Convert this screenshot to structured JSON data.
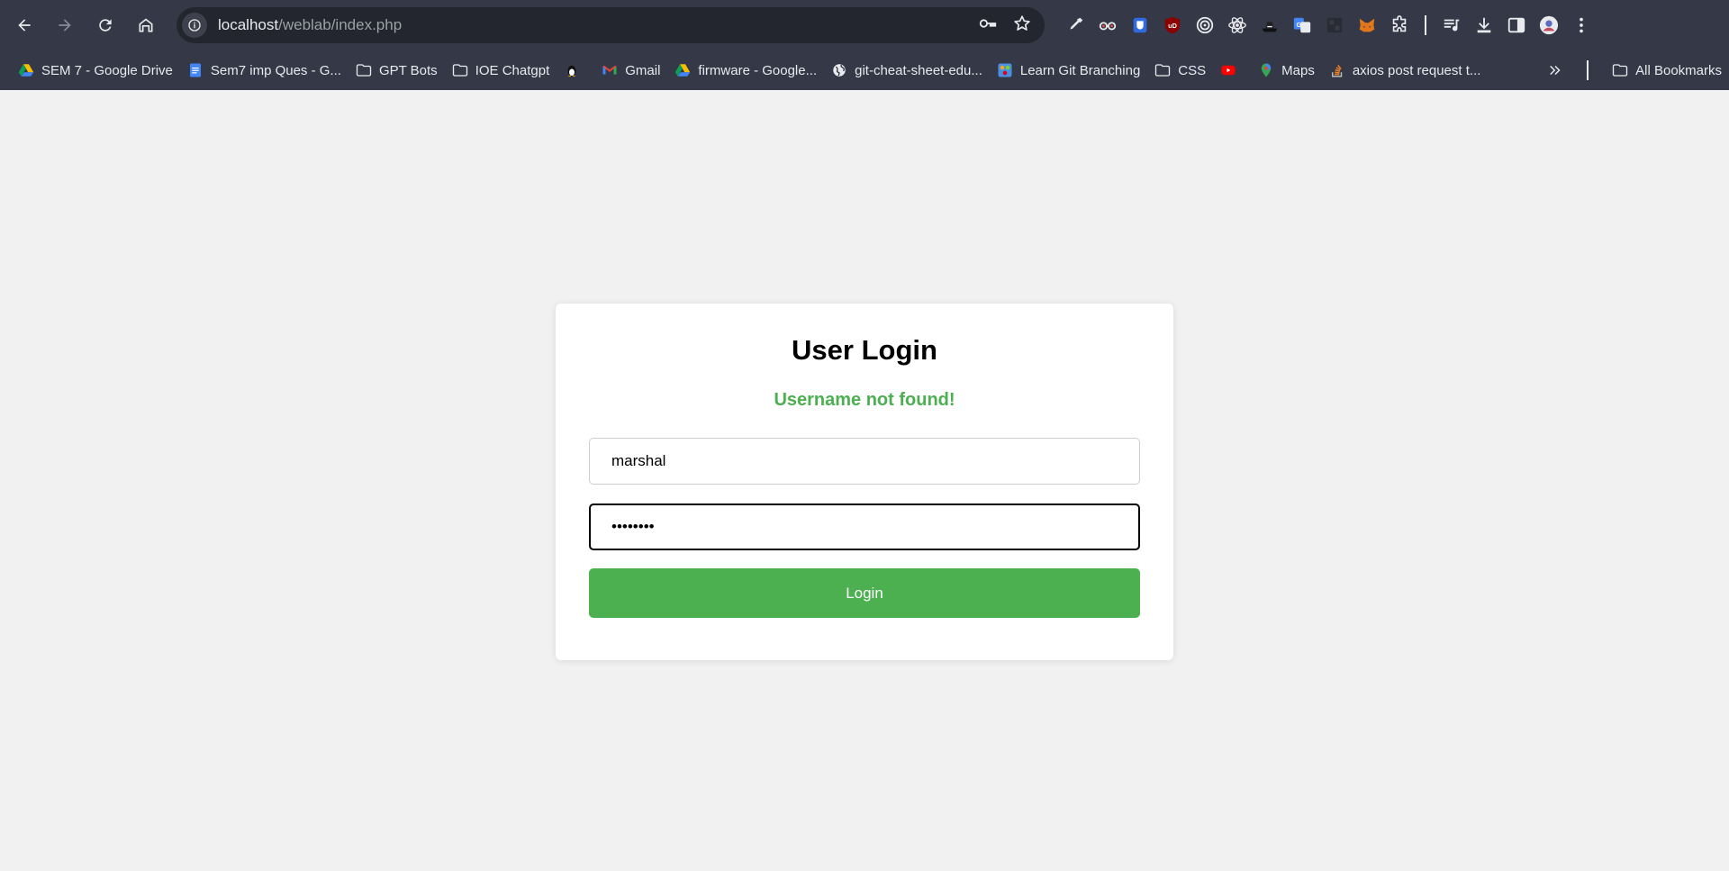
{
  "browser": {
    "url_host": "localhost",
    "url_path": "/weblab/index.php",
    "bookmarks": [
      {
        "label": "SEM 7 - Google Drive",
        "icon": "google-drive-icon"
      },
      {
        "label": "Sem7 imp Ques - G...",
        "icon": "google-docs-icon"
      },
      {
        "label": "GPT Bots",
        "icon": "folder-icon"
      },
      {
        "label": "IOE Chatgpt",
        "icon": "folder-icon"
      },
      {
        "label": "",
        "icon": "linux-penguin-icon"
      },
      {
        "label": "Gmail",
        "icon": "gmail-icon"
      },
      {
        "label": "firmware - Google...",
        "icon": "google-drive-icon"
      },
      {
        "label": "git-cheat-sheet-edu...",
        "icon": "globe-icon"
      },
      {
        "label": "Learn Git Branching",
        "icon": "learn-git-icon"
      },
      {
        "label": "CSS",
        "icon": "folder-icon"
      },
      {
        "label": "",
        "icon": "youtube-icon"
      },
      {
        "label": "Maps",
        "icon": "google-maps-icon"
      },
      {
        "label": "axios post request t...",
        "icon": "stackoverflow-icon"
      }
    ],
    "all_bookmarks_label": "All Bookmarks"
  },
  "login": {
    "title": "User Login",
    "message": "Username not found!",
    "username_value": "marshal",
    "password_value": "••••••••",
    "button_label": "Login"
  },
  "colors": {
    "accent": "#4caf50",
    "chrome_bg": "#353847",
    "omnibox_bg": "#24262f",
    "page_bg": "#f1f1f1"
  }
}
